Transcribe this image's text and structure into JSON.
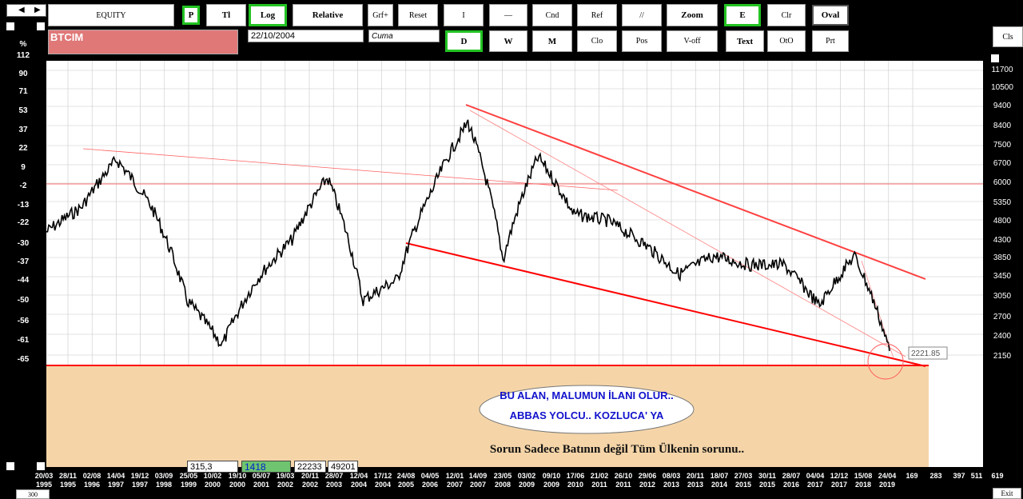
{
  "toolbar": {
    "equity": "EQUITY",
    "p": "P",
    "tl": "Tl",
    "log": "Log",
    "relative": "Relative",
    "grf": "Grf+",
    "reset": "Reset",
    "i": "I",
    "dash": "—",
    "cnd": "Cnd",
    "ref": "Ref",
    "slashes": "//",
    "zoom": "Zoom",
    "e": "E",
    "clr": "Clr",
    "oval": "Oval",
    "d": "D",
    "w": "W",
    "m": "M",
    "clo": "Clo",
    "pos": "Pos",
    "voff": "V-off",
    "text": "Text",
    "oto": "OtO",
    "prt": "Prt",
    "cls": "Cls"
  },
  "symbol": "BTCIM",
  "date": "22/10/2004",
  "day": "Cuma",
  "y_unit": "%",
  "left_axis": [
    "112",
    "90",
    "71",
    "53",
    "37",
    "22",
    "9",
    "-2",
    "-13",
    "-22",
    "-30",
    "-37",
    "-44",
    "-50",
    "-56",
    "-61",
    "-65"
  ],
  "right_axis": [
    "11700",
    "10500",
    "9400",
    "8400",
    "7500",
    "6700",
    "6000",
    "5350",
    "4800",
    "4300",
    "3850",
    "3450",
    "3050",
    "2700",
    "2400",
    "2150"
  ],
  "x_dates": [
    [
      "20/03",
      "1995"
    ],
    [
      "28/11",
      "1995"
    ],
    [
      "02/08",
      "1996"
    ],
    [
      "14/04",
      "1997"
    ],
    [
      "19/12",
      "1997"
    ],
    [
      "03/09",
      "1998"
    ],
    [
      "25/05",
      "1999"
    ],
    [
      "10/02",
      "2000"
    ],
    [
      "19/10",
      "2000"
    ],
    [
      "05/07",
      "2001"
    ],
    [
      "19/03",
      "2002"
    ],
    [
      "20/11",
      "2002"
    ],
    [
      "28/07",
      "2003"
    ],
    [
      "12/04",
      "2004"
    ],
    [
      "17/12",
      "2004"
    ],
    [
      "24/08",
      "2005"
    ],
    [
      "04/05",
      "2006"
    ],
    [
      "12/01",
      "2007"
    ],
    [
      "14/09",
      "2007"
    ],
    [
      "23/05",
      "2008"
    ],
    [
      "03/02",
      "2009"
    ],
    [
      "09/10",
      "2009"
    ],
    [
      "17/06",
      "2010"
    ],
    [
      "21/02",
      "2011"
    ],
    [
      "26/10",
      "2011"
    ],
    [
      "29/06",
      "2012"
    ],
    [
      "08/03",
      "2013"
    ],
    [
      "20/11",
      "2013"
    ],
    [
      "18/07",
      "2014"
    ],
    [
      "27/03",
      "2015"
    ],
    [
      "30/11",
      "2015"
    ],
    [
      "28/07",
      "2016"
    ],
    [
      "04/04",
      "2017"
    ],
    [
      "12/12",
      "2017"
    ],
    [
      "15/08",
      "2018"
    ],
    [
      "24/04",
      "2019"
    ],
    [
      "169",
      ""
    ],
    [
      "283",
      ""
    ],
    [
      "397",
      ""
    ],
    [
      "511",
      ""
    ],
    [
      "619",
      ""
    ]
  ],
  "price_label": "2221.85",
  "annotation": {
    "line1": "BU ALAN,  MALUMUN İLANI  OLUR..",
    "line2": "ABBAS    YOLCU..  KOZLUCA' YA",
    "footer": "Sorun Sadece Batının    değil     Tüm Ülkenin  sorunu.."
  },
  "status": {
    "v1": "315,3",
    "v2": "1418",
    "v3": "22233",
    "v4": "49201"
  },
  "bottom": {
    "left": "300",
    "exit": "Exit"
  },
  "colors": {
    "price": "#000000",
    "trend": "#ff0000",
    "zone": "#f5d5a8",
    "active": "#22c322",
    "symbol_bg": "#e07878"
  },
  "chart_data": {
    "type": "line",
    "series": [
      {
        "x": [
          "1995",
          "1996",
          "1997",
          "1998",
          "1999",
          "2000",
          "2001",
          "2002",
          "2003",
          "2004",
          "2005",
          "2006",
          "2007",
          "2008",
          "2009",
          "2010",
          "2011",
          "2012",
          "2013",
          "2014",
          "2015",
          "2016",
          "2017",
          "2018",
          "2019"
        ],
        "values": [
          4500,
          5200,
          6900,
          5200,
          3000,
          2300,
          3400,
          4300,
          6200,
          3000,
          3400,
          5800,
          8600,
          3800,
          7000,
          5000,
          4800,
          4200,
          3500,
          3900,
          3700,
          3700,
          2900,
          3900,
          2221.85
        ]
      }
    ],
    "ylim": [
      2150,
      11700
    ],
    "y_scale": "log"
  }
}
